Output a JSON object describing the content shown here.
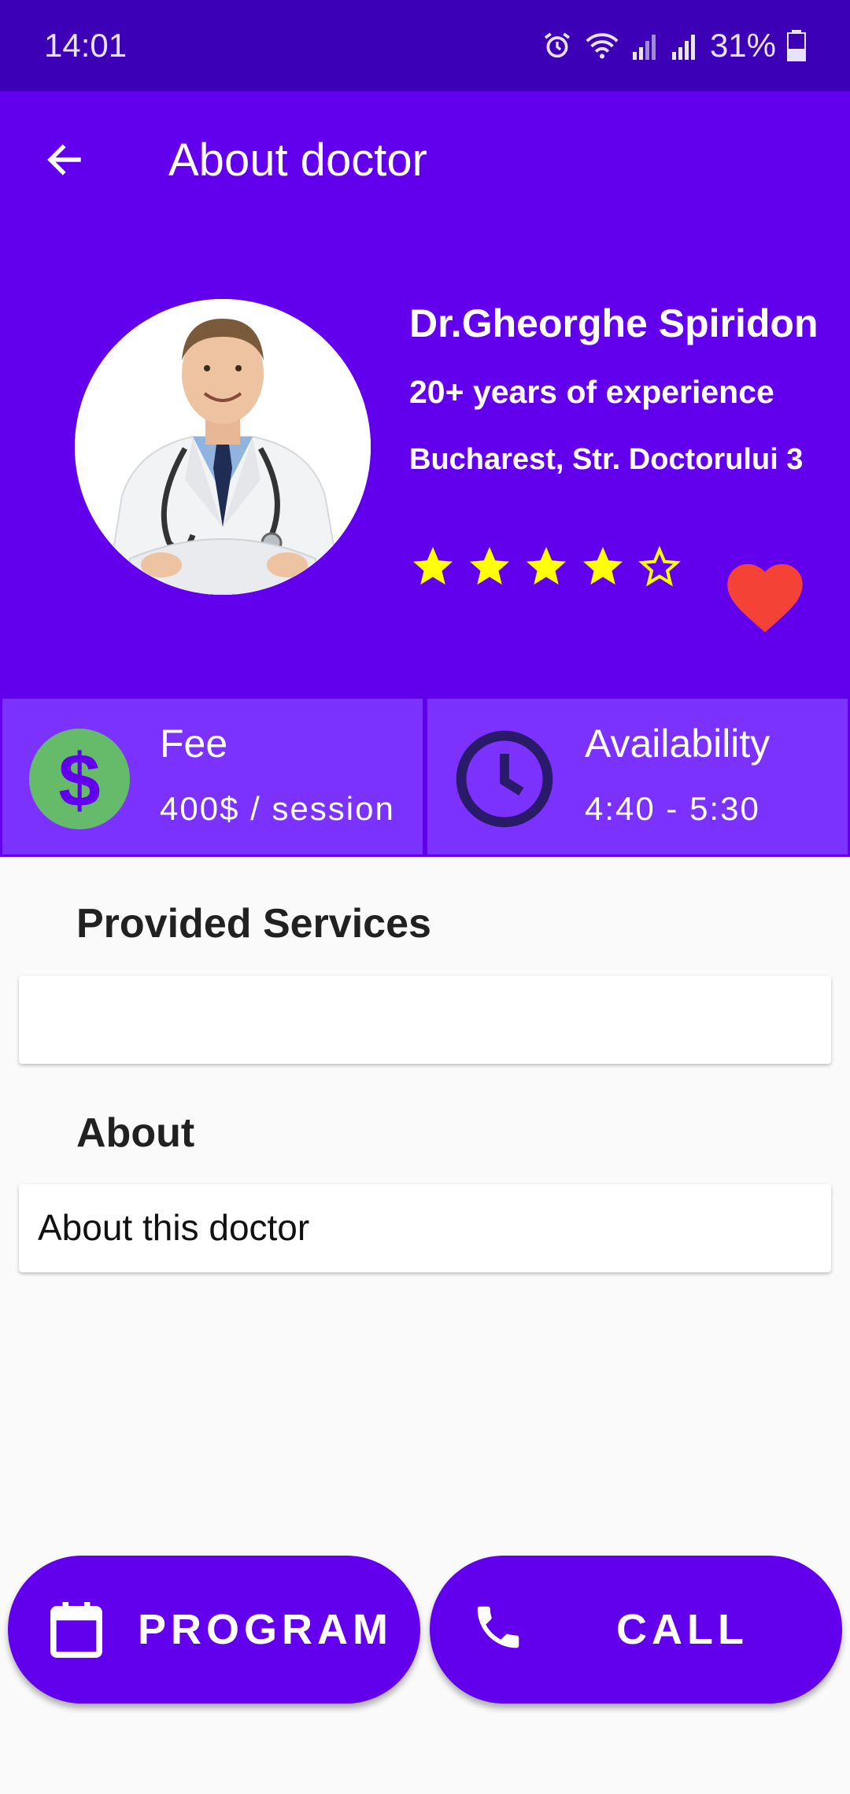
{
  "status_bar": {
    "time": "14:01",
    "battery": "31%"
  },
  "app_bar": {
    "title": "About doctor"
  },
  "doctor": {
    "name": "Dr.Gheorghe Spiridon",
    "experience": "20+ years of experience",
    "address": "Bucharest, Str. Doctorului 3",
    "rating": 4,
    "rating_max": 5
  },
  "fee": {
    "label": "Fee",
    "value": "400$ / session"
  },
  "availability": {
    "label": "Availability",
    "value": "4:40 - 5:30"
  },
  "sections": {
    "services_title": "Provided Services",
    "about_title": "About",
    "about_text": "About this doctor"
  },
  "buttons": {
    "program": "PROGRAM",
    "call": "CALL"
  },
  "colors": {
    "primary": "#6200ee",
    "status_bar": "#3c00b6",
    "card": "#7c32ff",
    "star": "#ffff00",
    "heart": "#f44336",
    "fee_icon": "#66bb6a"
  },
  "icons": {
    "back": "arrow-left-icon",
    "favorite": "heart-icon",
    "fee": "dollar-icon",
    "availability": "clock-icon",
    "program": "calendar-icon",
    "call": "phone-icon"
  }
}
